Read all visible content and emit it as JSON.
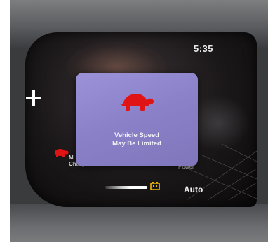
{
  "clock": {
    "time": "5:35"
  },
  "alert": {
    "icon": "turtle-icon",
    "line1": "Vehicle Speed",
    "line2": "May Be Limited",
    "background_color": "#8f86cd",
    "icon_color": "#e01414"
  },
  "cluster": {
    "left_indicator": {
      "icon": "turtle-icon",
      "label_line1": "M",
      "label_line2": "Charge"
    },
    "right_indicator": {
      "label_line1": "—",
      "label_line2": "Power"
    },
    "drive_mode": "Auto",
    "battery_icon": "battery-icon",
    "battery_color": "#f2b705",
    "add_icon": "plus-icon"
  }
}
